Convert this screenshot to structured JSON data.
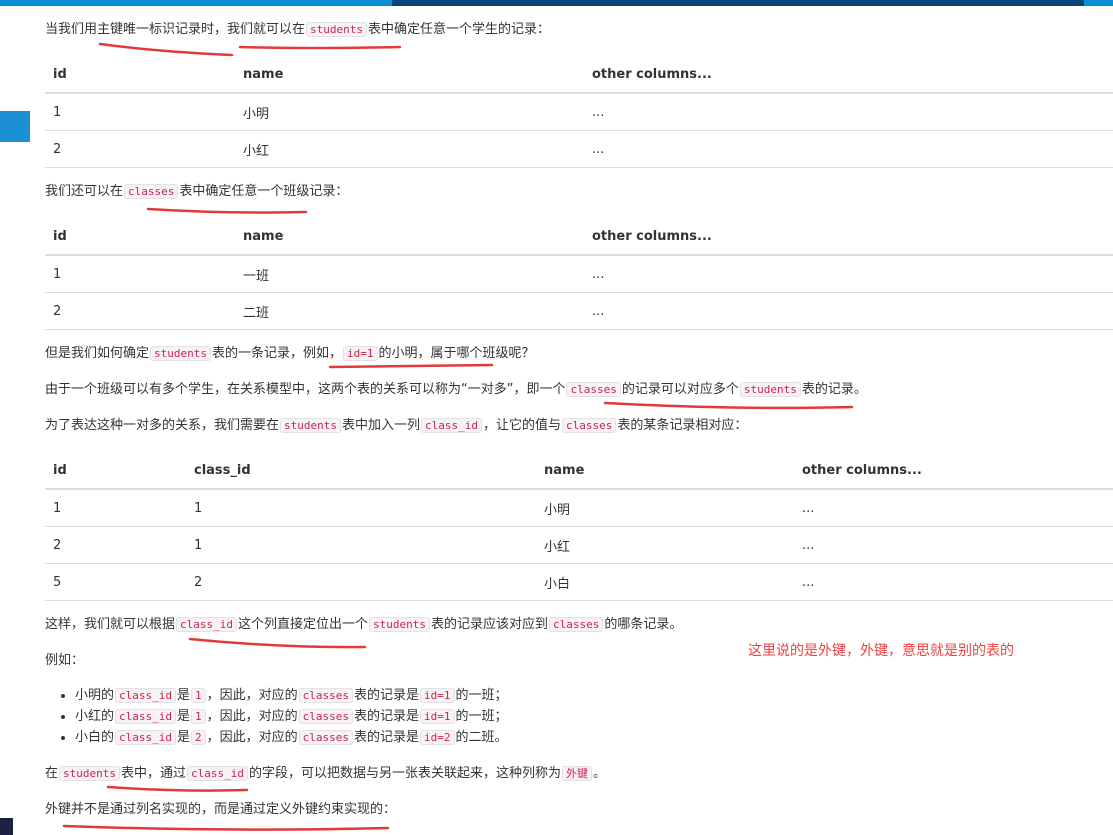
{
  "p1": {
    "a": "当我们用主键唯一标识记录时，我们就可以在",
    "code": "students",
    "b": "表中确定任意一个学生的记录："
  },
  "table1": {
    "headers": [
      "id",
      "name",
      "other columns..."
    ],
    "rows": [
      [
        "1",
        "小明",
        "..."
      ],
      [
        "2",
        "小红",
        "..."
      ]
    ]
  },
  "p2": {
    "a": "我们还可以在",
    "code": "classes",
    "b": "表中确定任意一个班级记录："
  },
  "table2": {
    "headers": [
      "id",
      "name",
      "other columns..."
    ],
    "rows": [
      [
        "1",
        "一班",
        "..."
      ],
      [
        "2",
        "二班",
        "..."
      ]
    ]
  },
  "p3": {
    "a": "但是我们如何确定",
    "code1": "students",
    "b": "表的一条记录，例如，",
    "code2": "id=1",
    "c": "的小明，属于哪个班级呢？"
  },
  "p4": {
    "a": "由于一个班级可以有多个学生，在关系模型中，这两个表的关系可以称为“一对多”，即一个",
    "code1": "classes",
    "b": "的记录可以对应多个",
    "code2": "students",
    "c": "表的记录。"
  },
  "p5": {
    "a": "为了表达这种一对多的关系，我们需要在",
    "code1": "students",
    "b": "表中加入一列",
    "code2": "class_id",
    "c": "，让它的值与",
    "code3": "classes",
    "d": "表的某条记录相对应："
  },
  "table3": {
    "headers": [
      "id",
      "class_id",
      "name",
      "other columns..."
    ],
    "rows": [
      [
        "1",
        "1",
        "小明",
        "..."
      ],
      [
        "2",
        "1",
        "小红",
        "..."
      ],
      [
        "5",
        "2",
        "小白",
        "..."
      ]
    ]
  },
  "p6": {
    "a": "这样，我们就可以根据",
    "code1": "class_id",
    "b": "这个列直接定位出一个",
    "code2": "students",
    "c": "表的记录应该对应到",
    "code3": "classes",
    "d": "的哪条记录。"
  },
  "p7": "例如：",
  "list": [
    {
      "a": "小明的",
      "code1": "class_id",
      "b": "是",
      "code2": "1",
      "c": "，因此，对应的",
      "code3": "classes",
      "d": "表的记录是",
      "code4": "id=1",
      "e": "的一班；"
    },
    {
      "a": "小红的",
      "code1": "class_id",
      "b": "是",
      "code2": "1",
      "c": "，因此，对应的",
      "code3": "classes",
      "d": "表的记录是",
      "code4": "id=1",
      "e": "的一班；"
    },
    {
      "a": "小白的",
      "code1": "class_id",
      "b": "是",
      "code2": "2",
      "c": "，因此，对应的",
      "code3": "classes",
      "d": "表的记录是",
      "code4": "id=2",
      "e": "的二班。"
    }
  ],
  "p8": {
    "a": "在",
    "code1": "students",
    "b": "表中，通过",
    "code2": "class_id",
    "c": "的字段，可以把数据与另一张表关联起来，这种列称为",
    "code3": "外键",
    "d": "。"
  },
  "p9": "外键并不是通过列名实现的，而是通过定义外键约束实现的：",
  "annotation": "这里说的是外键，外键，意思就是别的表的",
  "colors": {
    "code_text": "#c7254e",
    "code_bg": "#f9f2f4",
    "annotation": "#f04040",
    "topbar": "#0a8fd8",
    "accent": "#1a8fd3"
  }
}
